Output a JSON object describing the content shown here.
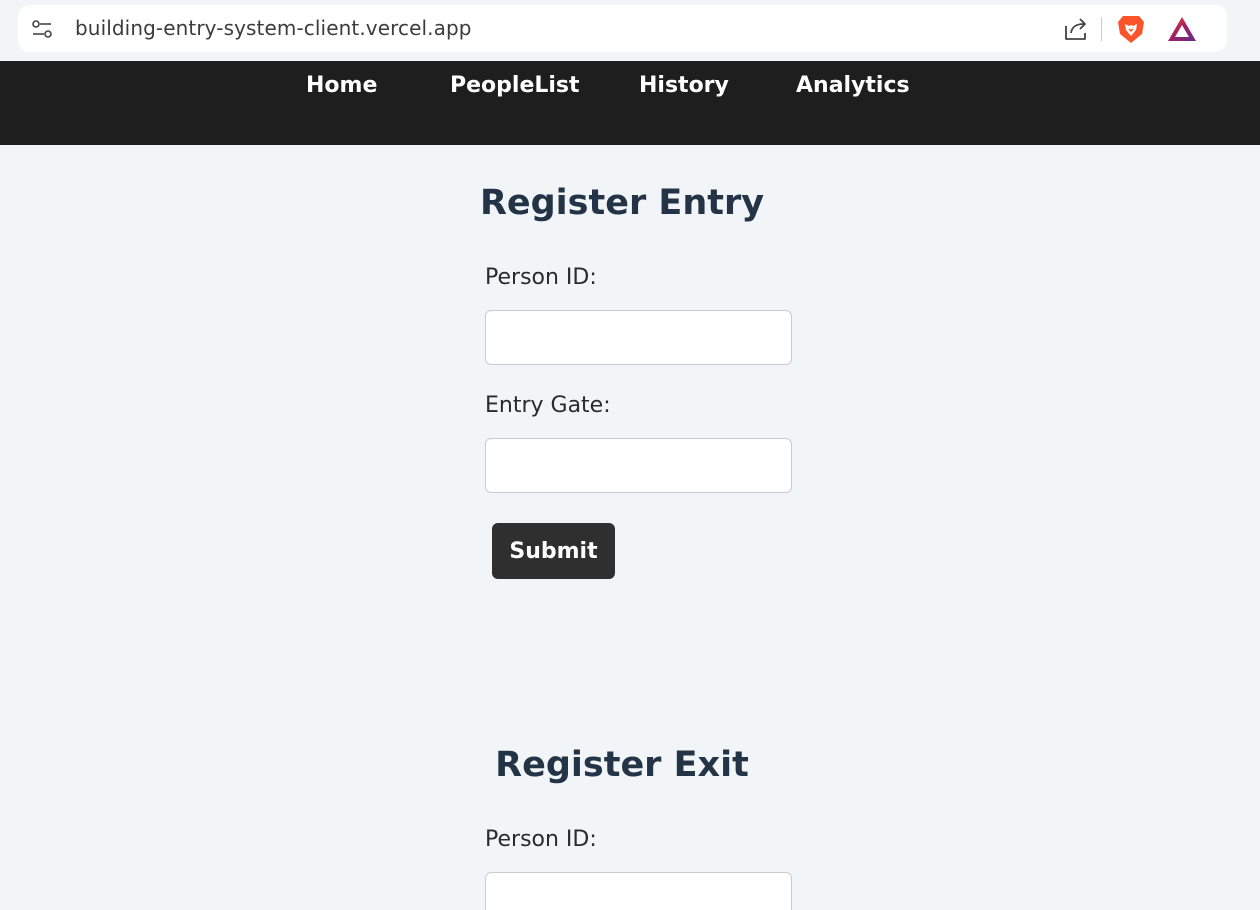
{
  "browser": {
    "url": "building-entry-system-client.vercel.app",
    "icons": [
      "site-settings-icon",
      "share-icon",
      "brave-lion-icon",
      "brave-rewards-icon"
    ]
  },
  "nav": {
    "items": [
      {
        "label": "Home"
      },
      {
        "label": "PeopleList"
      },
      {
        "label": "History"
      },
      {
        "label": "Analytics"
      }
    ]
  },
  "entry_form": {
    "title": "Register Entry",
    "person_id_label": "Person ID:",
    "person_id_value": "",
    "gate_label": "Entry Gate:",
    "gate_value": "",
    "submit_label": "Submit"
  },
  "exit_form": {
    "title": "Register Exit",
    "person_id_label": "Person ID:",
    "person_id_value": ""
  },
  "colors": {
    "navbar_bg": "#1e1e1e",
    "page_bg": "#f2f5f8",
    "title_color": "#243447",
    "button_bg": "#2f2f2f",
    "brave_orange": "#fb542b"
  }
}
